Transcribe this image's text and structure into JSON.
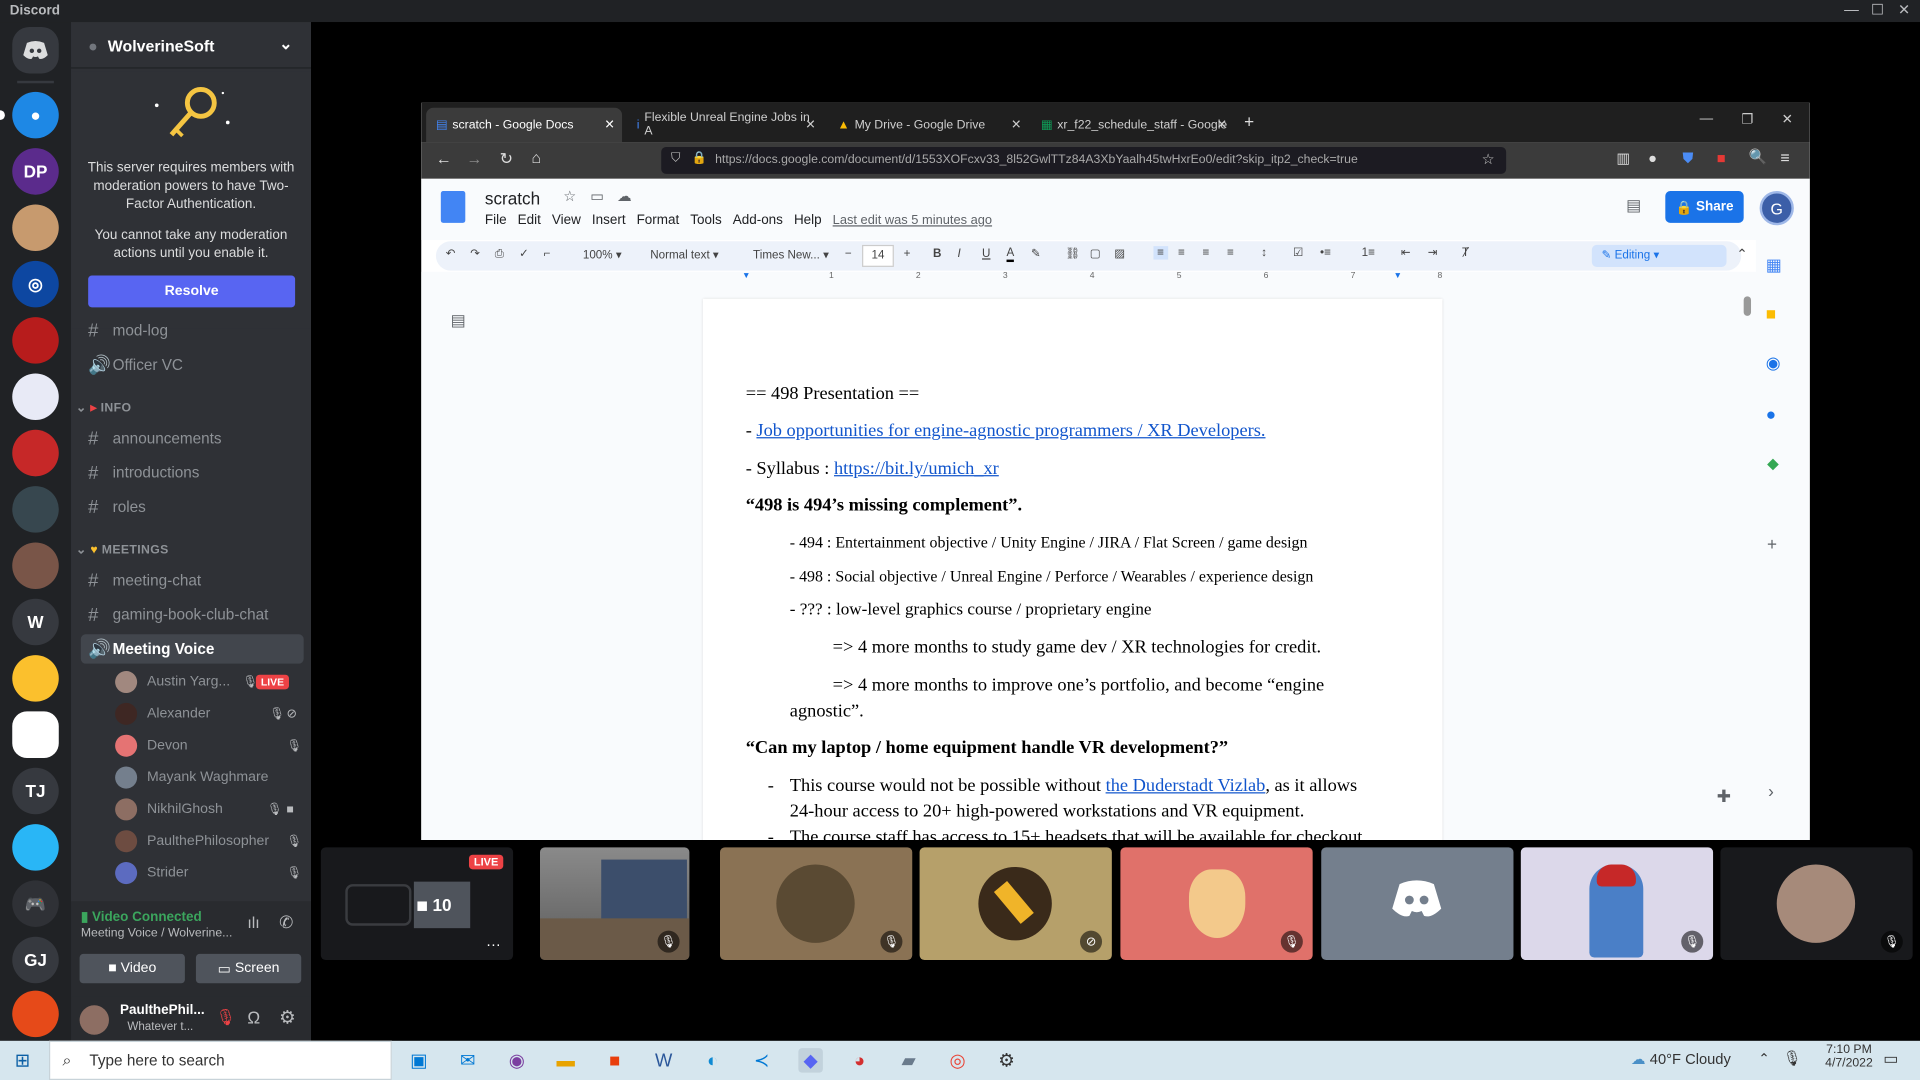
{
  "app": {
    "title": "Discord"
  },
  "server": {
    "name": "WolverineSoft",
    "notice_text": "This server requires members with moderation powers to have Two-Factor Authentication.",
    "notice_text2": "You cannot take any moderation actions until you enable it.",
    "resolve_label": "Resolve"
  },
  "channels": {
    "mod_log": "mod-log",
    "officer_vc": "Officer VC",
    "info_cat": "INFO",
    "announcements": "announcements",
    "introductions": "introductions",
    "roles": "roles",
    "meetings_cat": "MEETINGS",
    "meeting_chat": "meeting-chat",
    "gaming_book": "gaming-book-club-chat",
    "meeting_voice": "Meeting Voice"
  },
  "voice_users": [
    "Austin Yarg...",
    "Alexander",
    "Devon",
    "Mayank Waghmare",
    "NikhilGhosh",
    "PaulthePhilosopher",
    "Strider"
  ],
  "live_badge": "LIVE",
  "voice": {
    "status": "Video Connected",
    "channel": "Meeting Voice / Wolverine...",
    "video_label": "Video",
    "screen_label": "Screen"
  },
  "user": {
    "name": "PaulthePhil...",
    "status": "Whatever t..."
  },
  "server_rail": [
    "W",
    "TJ",
    "GJ"
  ],
  "browser": {
    "tabs": [
      "scratch - Google Docs",
      "Flexible Unreal Engine Jobs in A",
      "My Drive - Google Drive",
      "xr_f22_schedule_staff - Google"
    ],
    "url": "https://docs.google.com/document/d/1553XOFcxv33_8l52GwlTTz84A3XbYaalh45twHxrEo0/edit?skip_itp2_check=true"
  },
  "doc": {
    "title": "scratch",
    "menu": [
      "File",
      "Edit",
      "View",
      "Insert",
      "Format",
      "Tools",
      "Add-ons",
      "Help"
    ],
    "last_edit": "Last edit was 5 minutes ago",
    "share_label": "Share",
    "avatar": "G",
    "zoom": "100%",
    "style": "Normal text",
    "font": "Times New...",
    "size": "14",
    "mode": "Editing",
    "lines": {
      "l1": "== 498 Presentation ==",
      "l2_dash": "- ",
      "l2_link": "Job opportunities for engine-agnostic programmers / XR Developers.",
      "l3_pre": "- Syllabus : ",
      "l3_link": "https://bit.ly/umich_xr",
      "l4": "“498 is 494’s missing complement”.",
      "l5": "- 494 : Entertainment objective / Unity Engine / JIRA / Flat Screen / game design",
      "l6": "- 498 : Social objective / Unreal Engine / Perforce / Wearables / experience design",
      "l7": "- ??? : low-level graphics course / proprietary engine",
      "l8": "=> 4 more months to study game dev / XR technologies for credit.",
      "l9": "=> 4 more months to improve one’s portfolio, and become “engine",
      "l9b": "agnostic”.",
      "l10": "“Can my laptop / home equipment handle VR development?”",
      "l11_pre": "This course would not be possible without ",
      "l11_link": "the Duderstadt Vizlab",
      "l11_post": ", as it allows",
      "l11b": "24-hour access to 20+ high-powered workstations and VR equipment.",
      "l12": "The course staff has access to 15+ headsets that will be available for checkout.",
      "bullet": "-"
    }
  },
  "ruler_marks": [
    "1",
    "2",
    "3",
    "4",
    "5",
    "6",
    "7",
    "8"
  ],
  "taskbar": {
    "search_placeholder": "Type here to search",
    "weather": "40°F  Cloudy",
    "time": "7:10 PM",
    "date": "4/7/2022"
  },
  "tile_live": "LIVE",
  "tile_count": "10",
  "colors": {
    "blurple": "#5865f2",
    "discord_bg": "#36393f",
    "sidebar": "#2f3136",
    "live_red": "#ed4245",
    "link_blue": "#1155cc"
  }
}
